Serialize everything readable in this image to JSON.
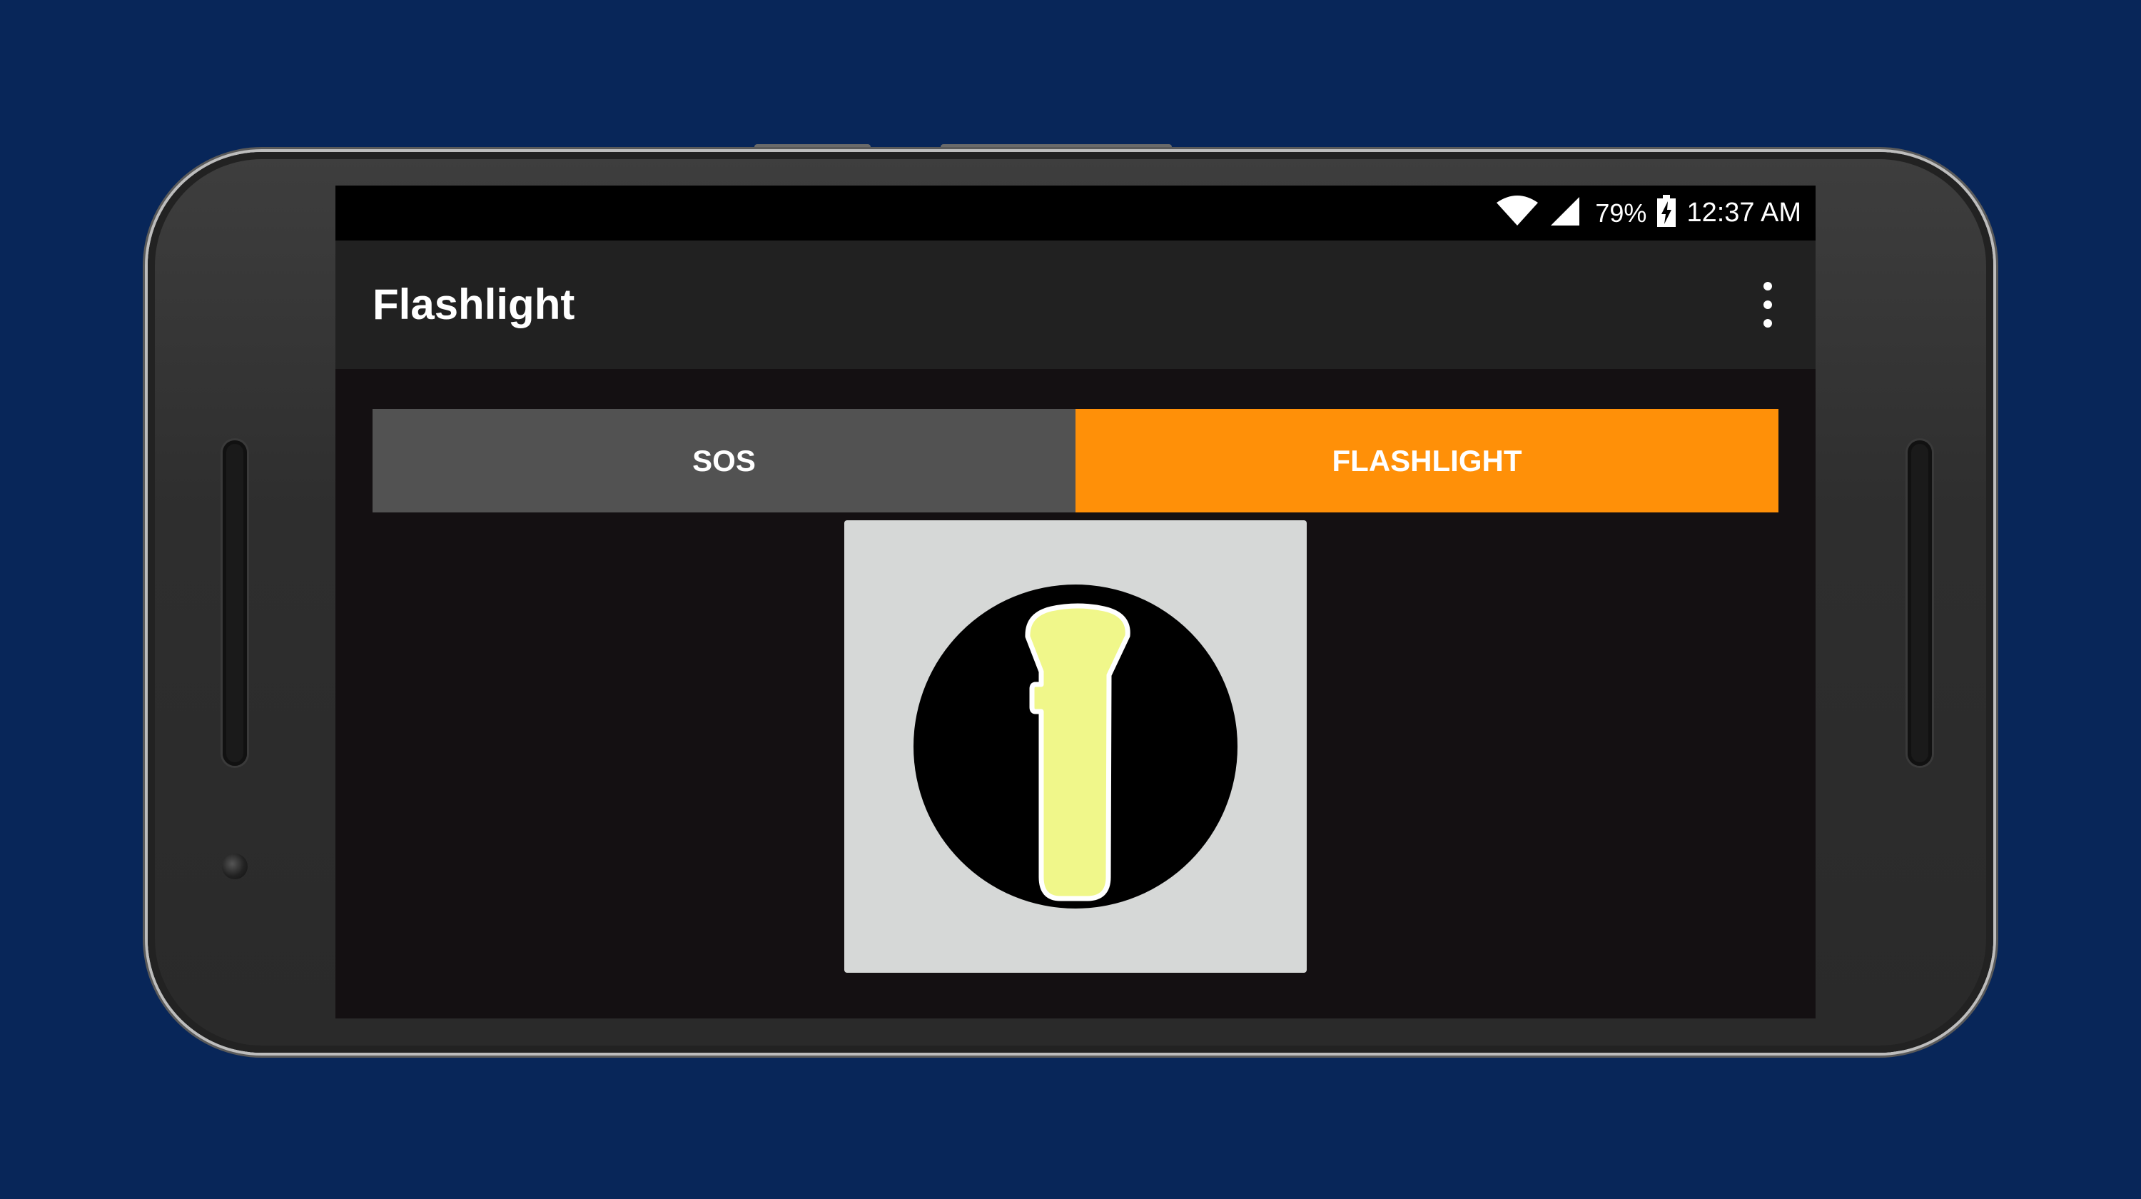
{
  "status_bar": {
    "battery_percent": "79%",
    "time": "12:37 AM",
    "icons": [
      "wifi-icon",
      "signal-icon",
      "battery-charging-icon"
    ]
  },
  "app_bar": {
    "title": "Flashlight",
    "menu_icon": "overflow-menu-icon"
  },
  "tabs": [
    {
      "label": "SOS",
      "selected": false
    },
    {
      "label": "FLASHLIGHT",
      "selected": true
    }
  ],
  "main": {
    "toggle_icon": "flashlight-icon"
  },
  "colors": {
    "background": "#082659",
    "accent": "#ff9008",
    "tab_inactive": "#525252",
    "app_bar": "#212121",
    "flashlight_glow": "#f0f78a"
  }
}
